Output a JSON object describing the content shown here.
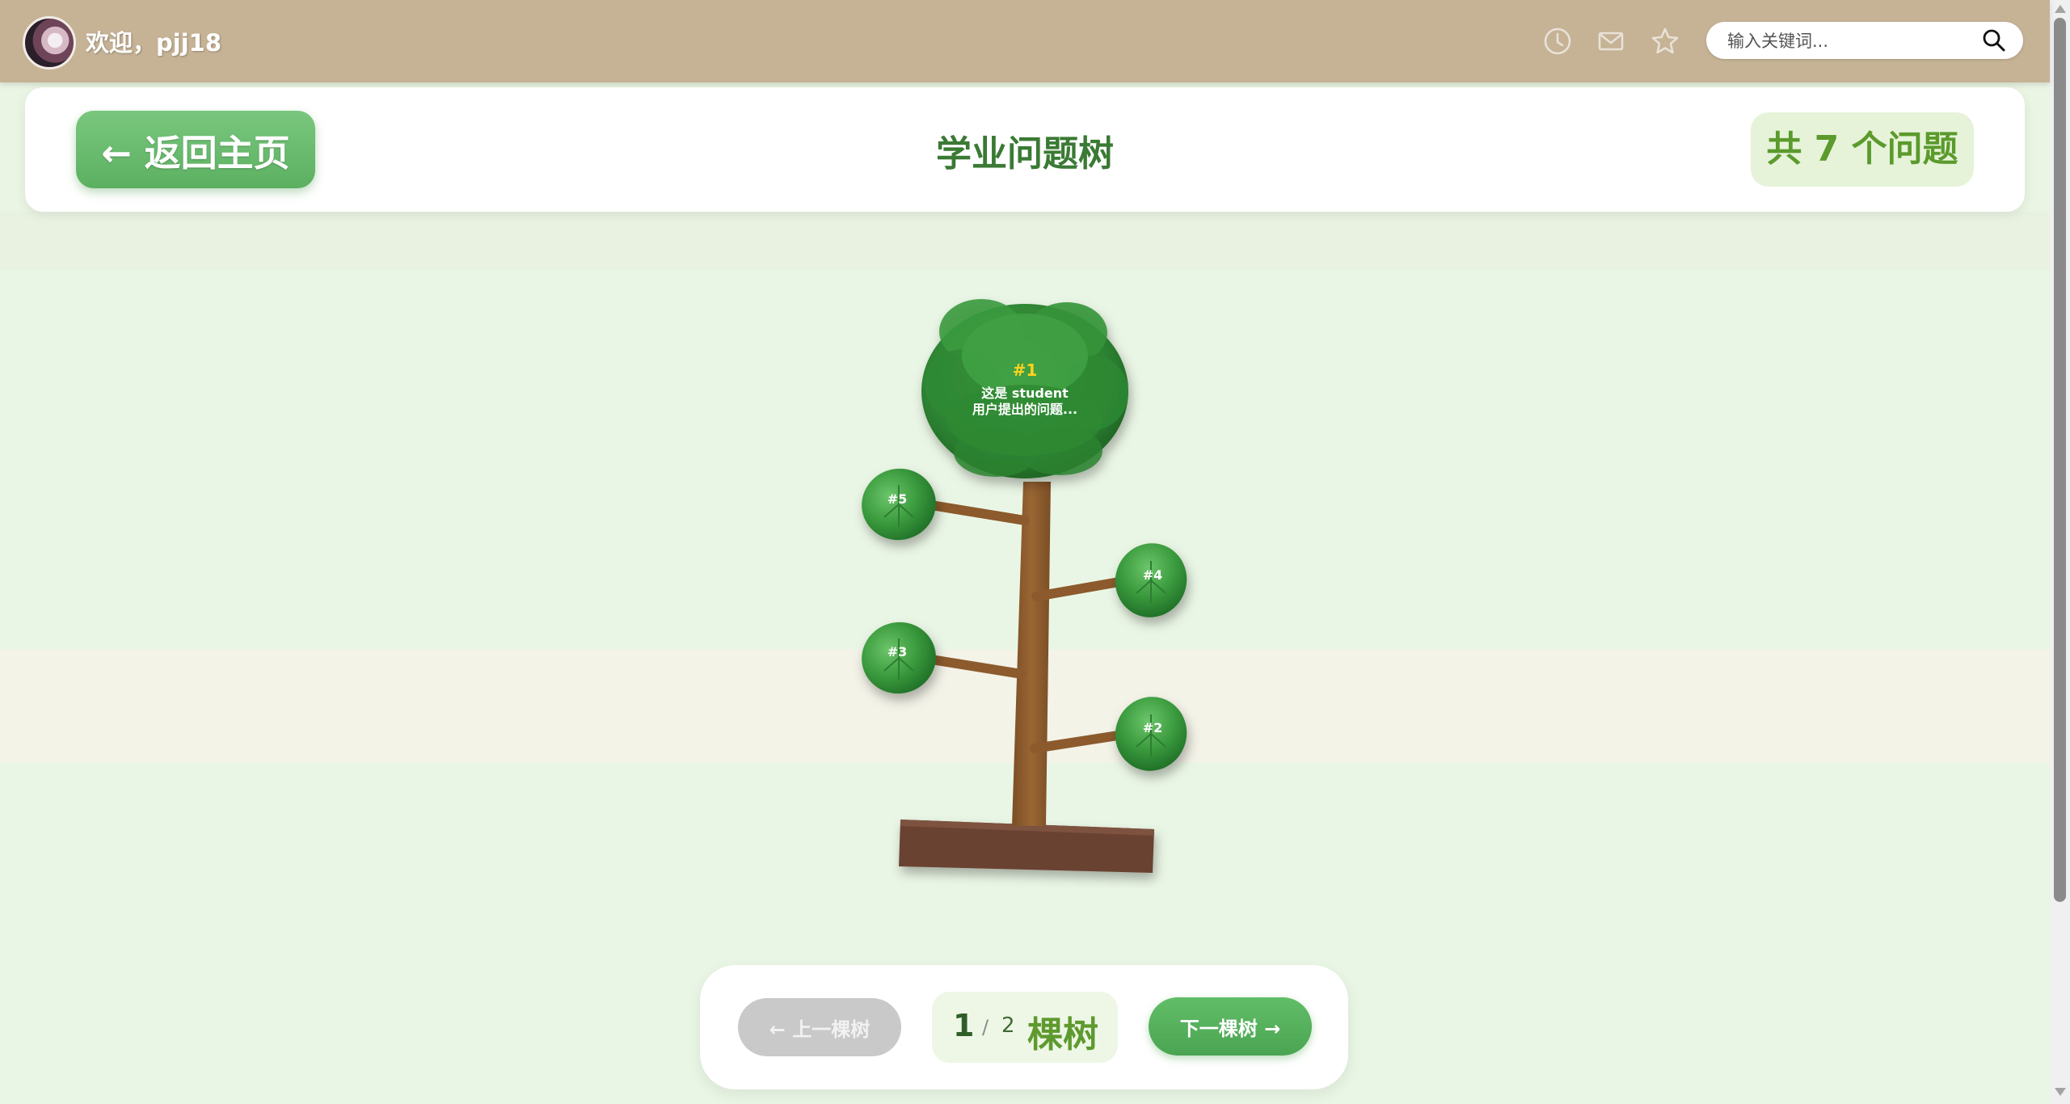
{
  "header": {
    "welcome_text": "欢迎，pjj18",
    "icons": [
      "clock-icon",
      "mail-icon",
      "star-icon"
    ],
    "search": {
      "placeholder": "输入关键词..."
    }
  },
  "page": {
    "back_label": "← 返回主页",
    "title": "学业问题树",
    "count_label": "共 7 个问题"
  },
  "tree": {
    "crown": {
      "label": "#1",
      "text_line1": "这是 student",
      "text_line2": "用户提出的问题..."
    },
    "leaves": [
      {
        "label": "#5"
      },
      {
        "label": "#4"
      },
      {
        "label": "#3"
      },
      {
        "label": "#2"
      }
    ]
  },
  "pager": {
    "prev_label": "← 上一棵树",
    "current": "1",
    "separator": "/",
    "total": "2",
    "unit": "棵树",
    "next_label": "下一棵树 →"
  },
  "colors": {
    "topbar": "#c6b295",
    "accent_green": "#5cb061",
    "title_green": "#3a7a34",
    "trunk": "#8a5a2b",
    "soil": "#6b4332",
    "leaf": "#3f9a3f",
    "crown_label": "#ffd21f"
  }
}
